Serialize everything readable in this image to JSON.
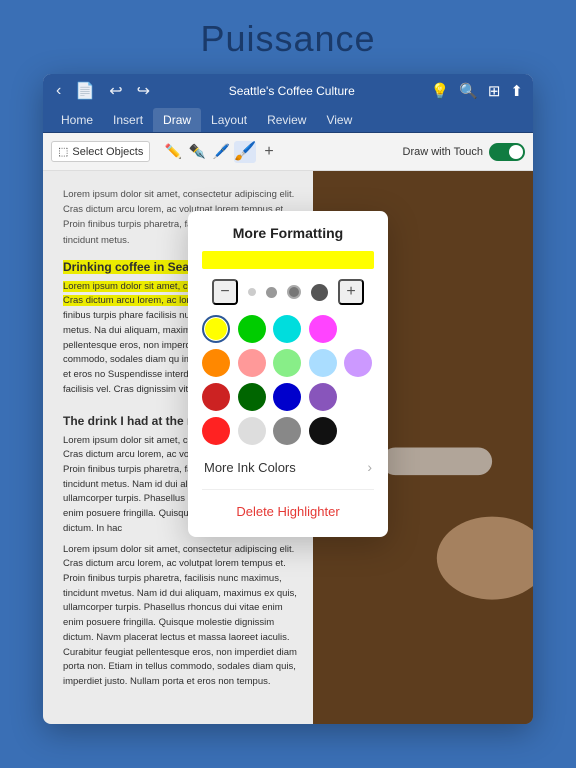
{
  "page": {
    "title": "Puissance"
  },
  "topbar": {
    "doc_title": "Seattle's Coffee Culture",
    "nav_back": "‹",
    "nav_undo": "↩",
    "nav_redo": "↪",
    "icons": [
      "♡",
      "🔍",
      "⊞",
      "⬆"
    ]
  },
  "ribbon": {
    "tabs": [
      "Home",
      "Insert",
      "Draw",
      "Layout",
      "Review",
      "View"
    ],
    "active": "Draw"
  },
  "toolbar": {
    "select_label": "Select Objects",
    "draw_touch_label": "Draw with Touch",
    "plus_label": "+"
  },
  "popup": {
    "title": "More Formatting",
    "preview_color": "#ffff00",
    "minus_label": "−",
    "plus_label": "+",
    "colors": [
      {
        "hex": "#ffff00",
        "name": "yellow",
        "selected": true
      },
      {
        "hex": "#00dd00",
        "name": "green"
      },
      {
        "hex": "#00dddd",
        "name": "cyan"
      },
      {
        "hex": "#ff44ff",
        "name": "magenta"
      },
      {
        "hex": "#ff8800",
        "name": "orange"
      },
      {
        "hex": "#ff6666",
        "name": "pink"
      },
      {
        "hex": "#88ee88",
        "name": "light-green"
      },
      {
        "hex": "#aaddff",
        "name": "light-blue"
      },
      {
        "hex": "#cc88ff",
        "name": "light-purple"
      },
      {
        "hex": "#dd2222",
        "name": "red"
      },
      {
        "hex": "#006600",
        "name": "dark-green"
      },
      {
        "hex": "#0000cc",
        "name": "dark-blue"
      },
      {
        "hex": "#8855bb",
        "name": "purple"
      },
      {
        "hex": "#ff2222",
        "name": "bright-red"
      },
      {
        "hex": "#cccccc",
        "name": "light-gray"
      },
      {
        "hex": "#888888",
        "name": "gray"
      },
      {
        "hex": "#222222",
        "name": "black"
      }
    ],
    "more_ink_label": "More Ink Colors",
    "delete_label": "Delete Highlighter"
  },
  "doc": {
    "heading1": "Drinking coffee in Seattle",
    "para1": "Lorem ipsum dolor sit amet, consectetur adipiscing elit. Cras dictum arcu lorem, ac volutpat lorem tempus et. Proin finibus turpis pharetra, facilisis nunc maximus, tincidunt metus.",
    "highlight_para": "Lorem ipsum dolor sit amet, consectetur adipiscing elit. Cras dictum arcu lorem, ac lorem tempus",
    "para2": " et. Proin finibus turpis phare facilisis nunc maximus, tincidunt metus. Na dui aliquam, maximus ex quis, ullamcorpe pellentesque eros, non imperdiet diam po Etiam in tellus commodo, sodales diam qu imperdiet justo. Nullam porta et eros no Suspendisse interdum quam felis, at po facilisis vel. Cras dignissim vitae tortor v",
    "heading2": "The drink I had at the roastery",
    "para3": "Lorem ipsum dolor sit amet, consectetur adipiscing elit. Cras dictum arcu lorem, ac volutpat lorem tempus et. Proin finibus turpis pharetra, facilisis nunc maximus, tincidunt metus. Nam id dui aliquam, maximus ex quis, ullamcorper turpis. Phasellus rhoncus dui vitae enim enim posuere fringilla. Quisque molestie dignissim dictum. In hac",
    "para4": "Lorem ipsum dolor sit amet, consectetur adipiscing elit. Cras dictum arcu lorem, ac volutpat lorem tempus et. Proin finibus turpis pharetra, facilisis nunc maximus, tincidunt mvetus. Nam id dui aliquam, maximus ex quis, ullamcorper turpis. Phasellus rhoncus dui vitae enim enim posuere fringilla. Quisque molestie dignissim dictum. Navm placerat lectus et massa laoreet iaculis. Curabitur feugiat pellentesque eros, non imperdiet diam porta non. Etiam in tellus commodo, sodales diam quis, imperdiet justo. Nullam porta et eros non tempus."
  }
}
